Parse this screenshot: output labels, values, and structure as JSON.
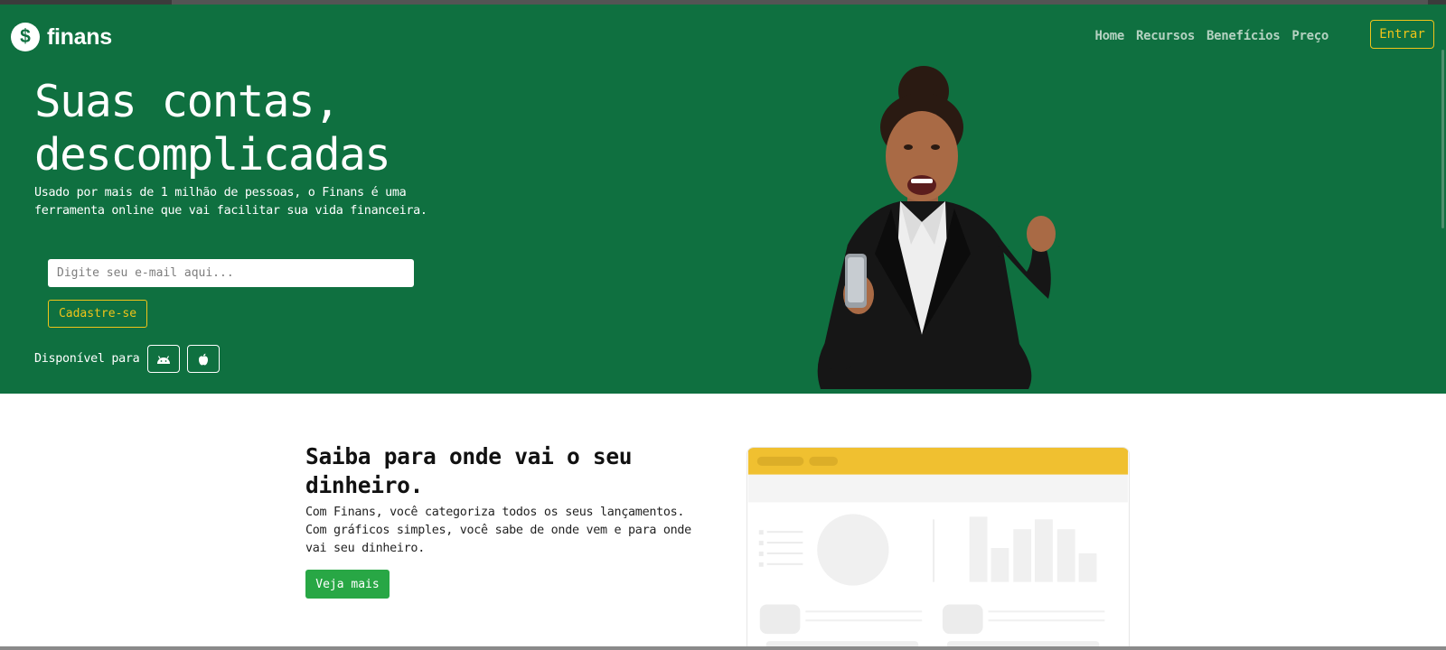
{
  "brand": {
    "name": "finans",
    "icon": "dollar-circle-icon"
  },
  "nav": {
    "items": [
      "Home",
      "Recursos",
      "Benefícios",
      "Preço"
    ],
    "login_label": "Entrar"
  },
  "hero": {
    "title_line1": "Suas contas,",
    "title_line2": "descomplicadas",
    "description": "Usado por mais de 1 milhão de pessoas, o Finans é uma ferramenta online que vai facilitar sua vida financeira.",
    "email_placeholder": "Digite seu e-mail aqui...",
    "signup_label": "Cadastre-se",
    "available_label": "Disponível para",
    "platforms": [
      "android-icon",
      "apple-icon"
    ]
  },
  "feature": {
    "title": "Saiba para onde vai o seu dinheiro.",
    "description": "Com Finans, você categoriza todos os seus lançamentos. Com gráficos simples, você sabe de onde vem e para onde vai seu dinheiro.",
    "cta_label": "Veja mais"
  },
  "colors": {
    "hero_bg": "#0f7040",
    "accent_yellow": "#f0c419",
    "cta_green": "#28a745",
    "nav_text": "#b4d2c1"
  }
}
